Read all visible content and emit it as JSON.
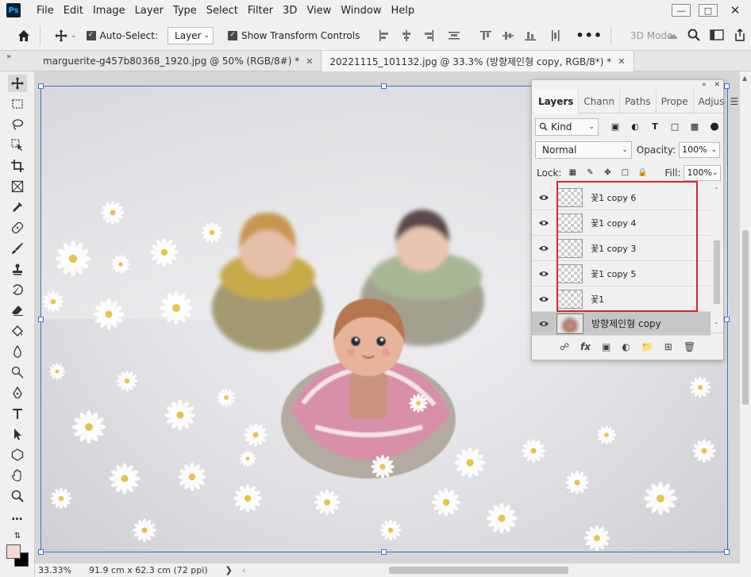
{
  "app": {
    "logo": "Ps",
    "menu": [
      "File",
      "Edit",
      "Image",
      "Layer",
      "Type",
      "Select",
      "Filter",
      "3D",
      "View",
      "Window",
      "Help"
    ]
  },
  "options_bar": {
    "auto_select_label": "Auto-Select:",
    "auto_select_target": "Layer",
    "transform_controls_label": "Show Transform Controls",
    "mode_3d_label": "3D Mode:",
    "more": "•••"
  },
  "tabs": [
    {
      "label": "marguerite-g457b80368_1920.jpg @ 50% (RGB/8#) *",
      "active": false
    },
    {
      "label": "20221115_101132.jpg @ 33.3% (방향제인형 copy, RGB/8*) *",
      "active": true
    }
  ],
  "tab_collapse": "»",
  "status": {
    "zoom": "33.33%",
    "doc_size": "91.9 cm x 62.3 cm (72 ppi)",
    "arrow": "❯",
    "left_arrow": "‹"
  },
  "colors": {
    "foreground": "#f7d6d6",
    "background": "#000000",
    "highlight": "#d6262b",
    "transform": "#3b6fd6"
  },
  "layers_panel": {
    "tabs": [
      "Layers",
      "Chann",
      "Paths",
      "Prope",
      "Adjus"
    ],
    "active_tab": "Layers",
    "kind_label": "Kind",
    "blend_mode": "Normal",
    "opacity_label": "Opacity:",
    "opacity_value": "100%",
    "lock_label": "Lock:",
    "fill_label": "Fill:",
    "fill_value": "100%",
    "layers": [
      {
        "name": "꽃1 copy 6",
        "visible": true,
        "selected": false
      },
      {
        "name": "꽃1 copy 4",
        "visible": true,
        "selected": false
      },
      {
        "name": "꽃1 copy 3",
        "visible": true,
        "selected": false
      },
      {
        "name": "꽃1 copy 5",
        "visible": true,
        "selected": false
      },
      {
        "name": "꽃1",
        "visible": true,
        "selected": false
      },
      {
        "name": "방향제인형  copy",
        "visible": true,
        "selected": true
      }
    ],
    "footer_icons": [
      "link-icon",
      "fx-icon",
      "mask-icon",
      "adjustment-icon",
      "folder-icon",
      "new-layer-icon",
      "trash-icon"
    ],
    "fx_label": "fx"
  }
}
